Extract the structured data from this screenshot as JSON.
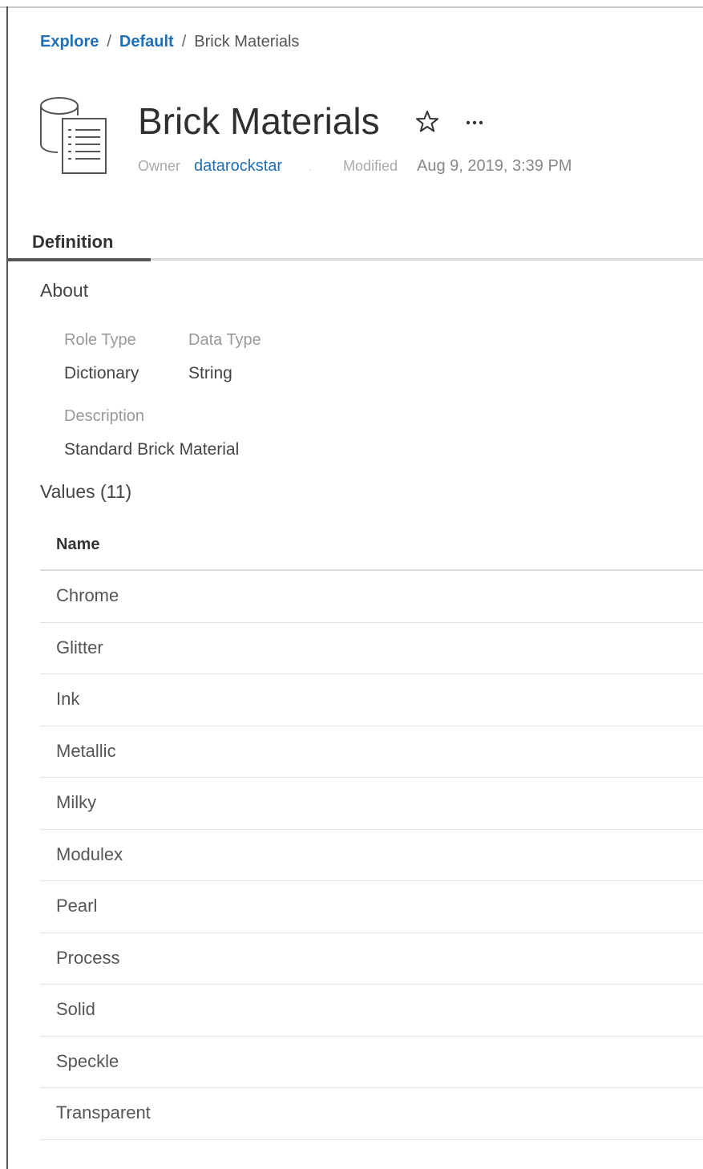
{
  "breadcrumb": {
    "items": [
      "Explore",
      "Default"
    ],
    "separator": "/",
    "current": "Brick Materials"
  },
  "header": {
    "title": "Brick Materials",
    "owner_label": "Owner",
    "owner": "datarockstar",
    "modified_label": "Modified",
    "modified": "Aug 9, 2019, 3:39 PM"
  },
  "tabs": [
    {
      "label": "Definition",
      "active": true
    }
  ],
  "about": {
    "heading": "About",
    "role_type_label": "Role Type",
    "role_type": "Dictionary",
    "data_type_label": "Data Type",
    "data_type": "String",
    "description_label": "Description",
    "description": "Standard Brick Material"
  },
  "values": {
    "heading": "Values (11)",
    "column_header": "Name",
    "rows": [
      "Chrome",
      "Glitter",
      "Ink",
      "Metallic",
      "Milky",
      "Modulex",
      "Pearl",
      "Process",
      "Solid",
      "Speckle",
      "Transparent"
    ]
  },
  "colors": {
    "link": "#1f6fb5",
    "text": "#333333",
    "muted": "#999999",
    "divider": "#d9d9d9"
  },
  "icons": {
    "dictionary": "dictionary-icon",
    "favorite": "star-icon",
    "more": "more-actions-icon"
  }
}
